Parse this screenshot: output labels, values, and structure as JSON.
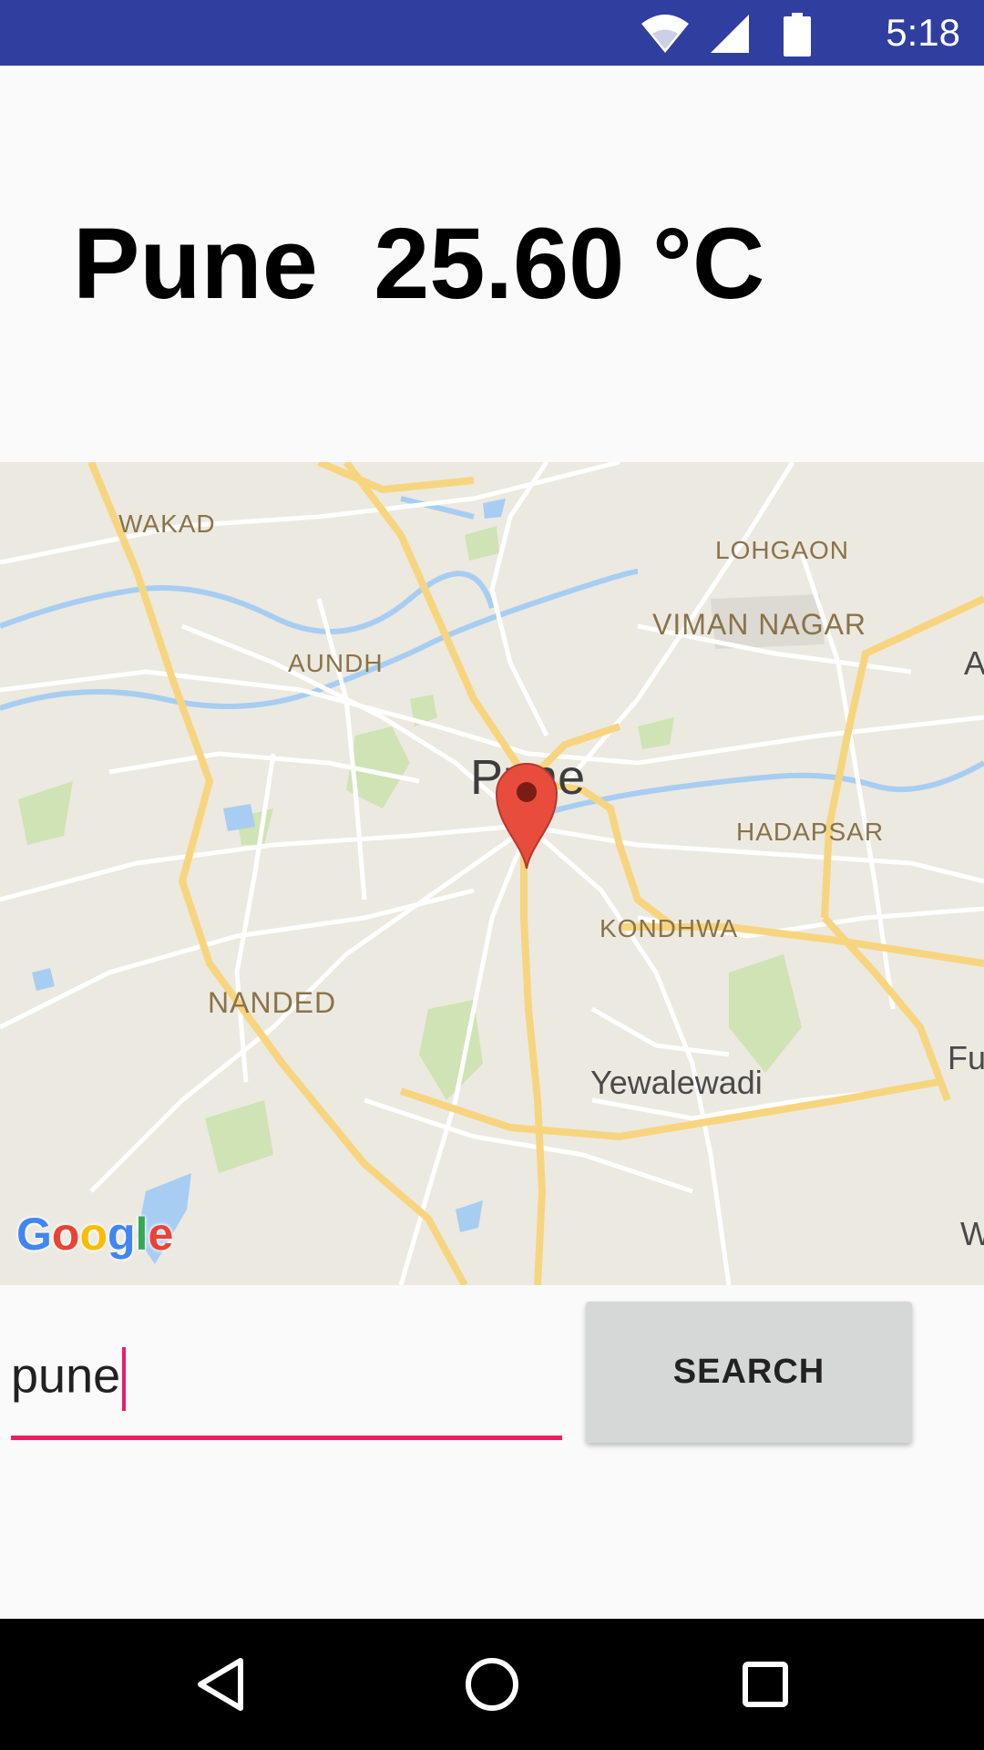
{
  "status_bar": {
    "time": "5:18",
    "icons": [
      "wifi-icon",
      "cell-signal-icon",
      "battery-icon"
    ],
    "background": "#303f9f"
  },
  "weather": {
    "city": "Pune",
    "temperature": "25.60 °C"
  },
  "map": {
    "labels": {
      "wakad": "WAKAD",
      "lohgaon": "LOHGAON",
      "viman_nagar": "VIMAN NAGAR",
      "aundh": "AUNDH",
      "pune": "Pune",
      "hadapsar": "HADAPSAR",
      "kondhwa": "KONDHWA",
      "nanded": "NANDED",
      "yewalewadi": "Yewalewadi",
      "edge_a": "A",
      "edge_fu": "Fu",
      "edge_w": "W"
    },
    "attribution": "Google",
    "marker": "location-pin-icon"
  },
  "search": {
    "value": "pune",
    "button_label": "SEARCH",
    "accent": "#e91e63"
  },
  "nav_bar": {
    "icons": [
      "back-icon",
      "home-icon",
      "recents-icon"
    ]
  }
}
